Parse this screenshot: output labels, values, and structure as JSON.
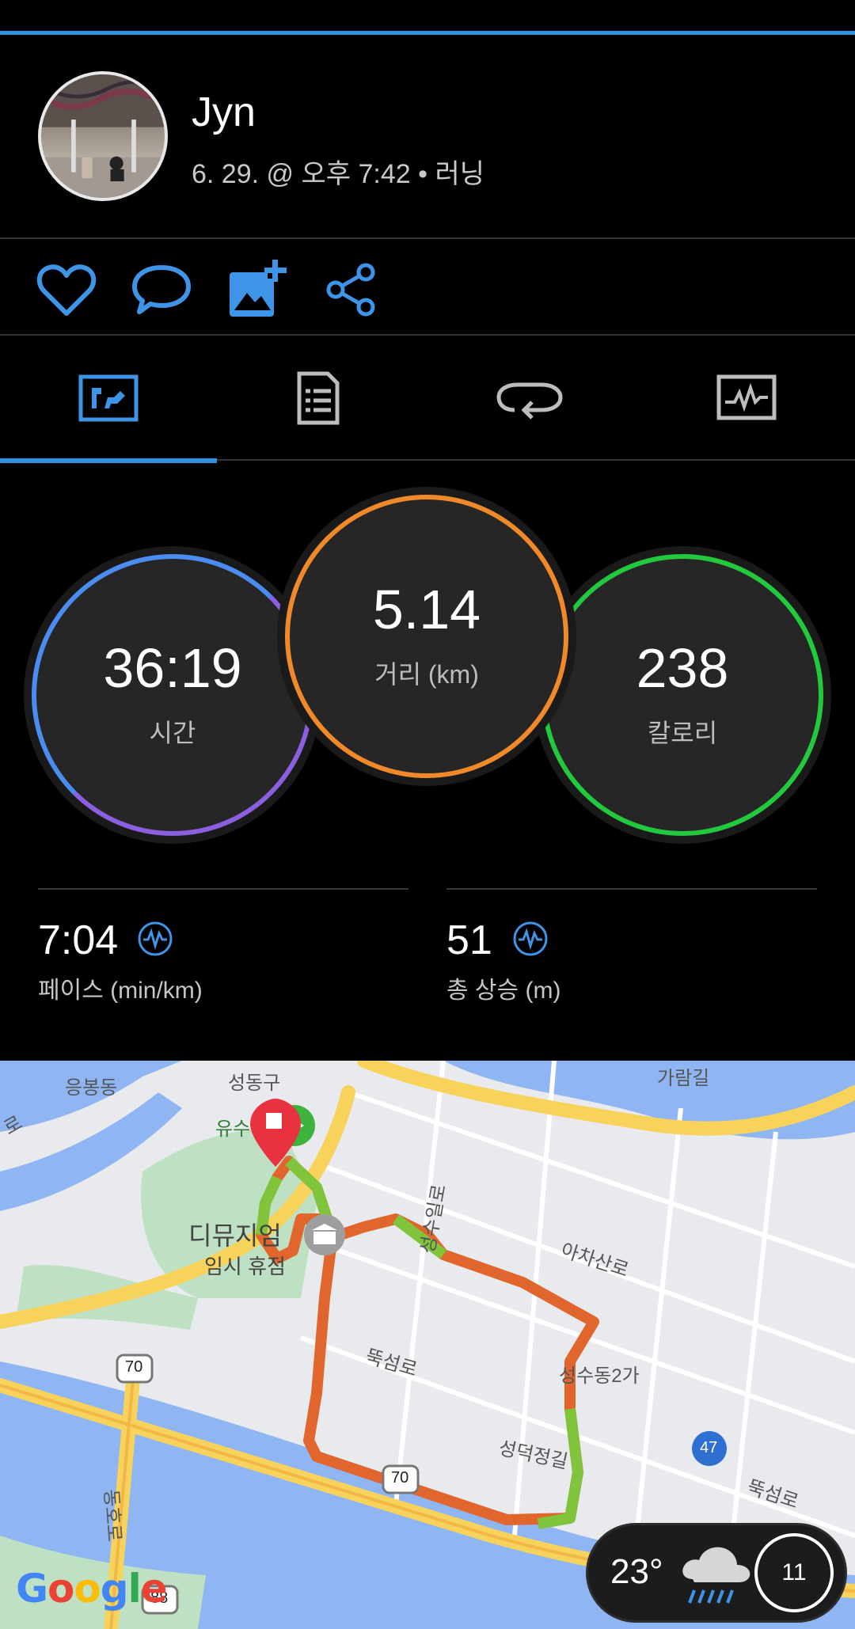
{
  "profile": {
    "name": "Jyn",
    "meta": "6. 29. @ 오후 7:42 • 러닝"
  },
  "actions": [
    "heart-icon",
    "comment-icon",
    "add-photo-icon",
    "share-icon"
  ],
  "tabs": [
    "stats-tab-icon",
    "details-tab-icon",
    "laps-tab-icon",
    "charts-tab-icon"
  ],
  "active_tab": 0,
  "summary": {
    "time": {
      "value": "36:19",
      "label": "시간",
      "color": "#6b6fe0"
    },
    "distance": {
      "value": "5.14",
      "label": "거리 (km)",
      "color": "#f0892a"
    },
    "calories": {
      "value": "238",
      "label": "칼로리",
      "color": "#22c93c"
    }
  },
  "stats": {
    "pace": {
      "value": "7:04",
      "label": "페이스 (min/km)"
    },
    "ascent": {
      "value": "51",
      "label": "총 상승 (m)"
    }
  },
  "map": {
    "labels": {
      "eungbong": "응봉동",
      "seongdong": "성동구",
      "garam": "가람길",
      "yusu": "유수",
      "museum": "디뮤지엄",
      "museum_sub": "임시 휴점",
      "seongsu_ilro": "성수일로",
      "acha": "아차산로",
      "ttukseom": "뚝섬로",
      "seongsu2ga": "성수동2가",
      "seongdeok": "성덕정길",
      "ttukseom2": "뚝섬로",
      "dongho": "동호로",
      "road70a": "70",
      "road70b": "70",
      "road88": "88",
      "road47": "47",
      "left_edge": "로"
    },
    "attribution": "Google"
  },
  "weather": {
    "temperature": "23°",
    "uv": "11"
  }
}
